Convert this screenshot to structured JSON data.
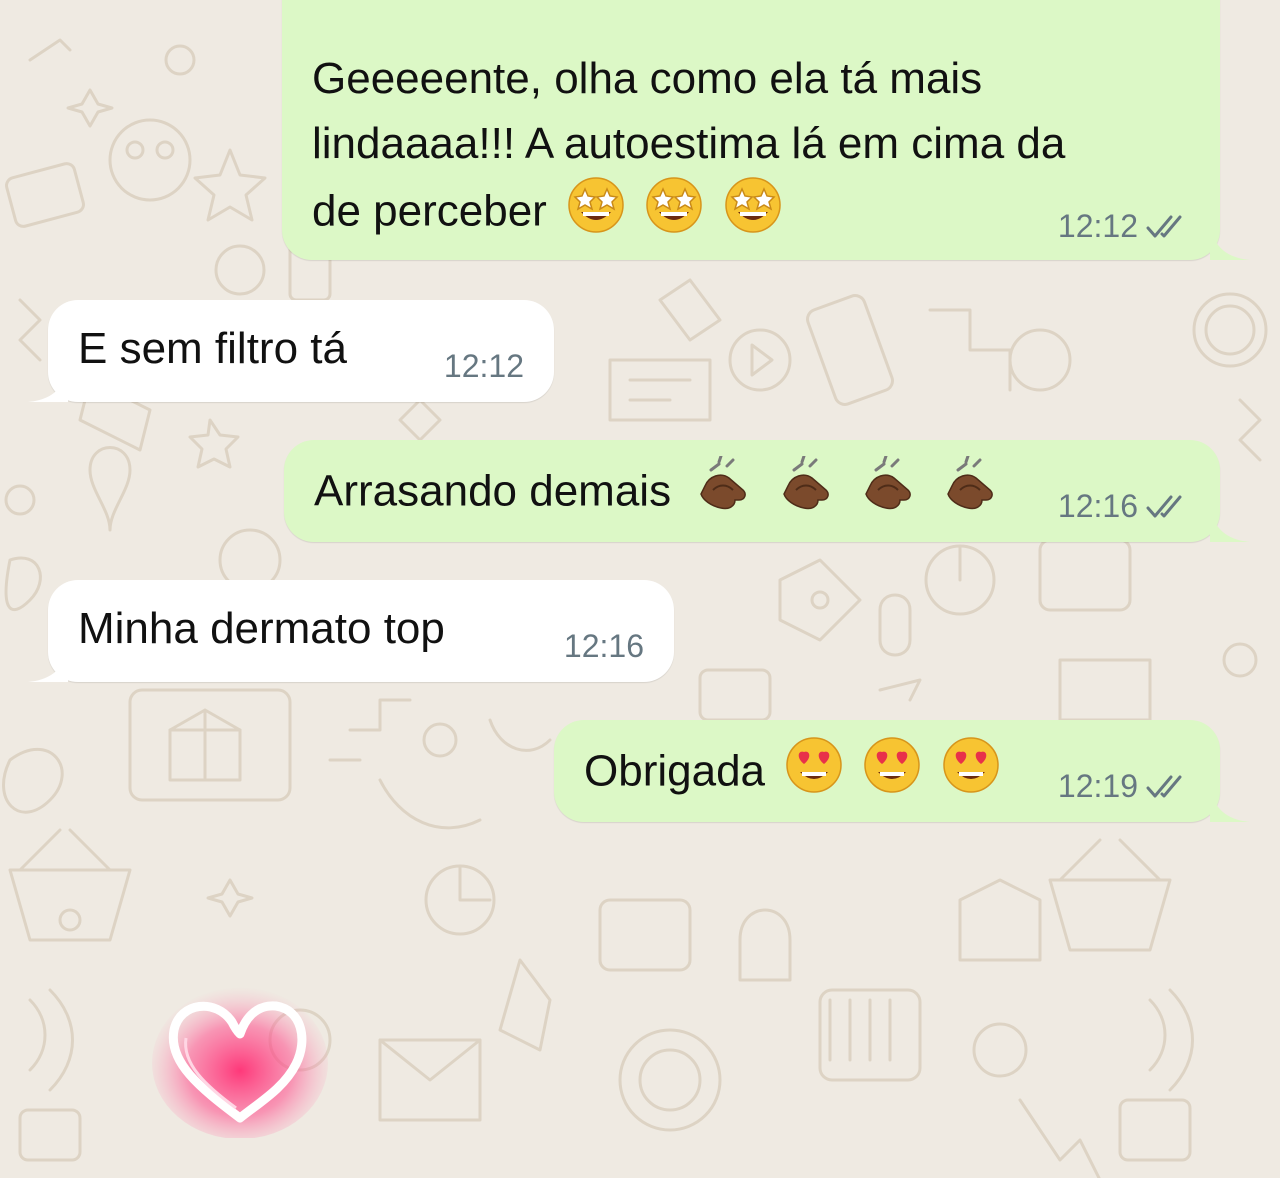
{
  "chat": {
    "messages": [
      {
        "direction": "outgoing",
        "lines": [
          "Geeeeente, olha como ela tá mais",
          "lindaaaa!!! A autoestima lá em cima da",
          "de perceber"
        ],
        "emoji": [
          "star-struck",
          "star-struck",
          "star-struck"
        ],
        "time": "12:12",
        "status": "read"
      },
      {
        "direction": "incoming",
        "text": "E sem filtro tá",
        "time": "12:12"
      },
      {
        "direction": "outgoing",
        "text": "Arrasando demais",
        "emoji": [
          "clapping-hands",
          "clapping-hands",
          "clapping-hands",
          "clapping-hands"
        ],
        "time": "12:16",
        "status": "read"
      },
      {
        "direction": "incoming",
        "text": "Minha dermato top",
        "time": "12:16"
      },
      {
        "direction": "outgoing",
        "text": "Obrigada",
        "emoji": [
          "heart-eyes",
          "heart-eyes",
          "heart-eyes"
        ],
        "time": "12:19",
        "status": "read"
      }
    ]
  },
  "colors": {
    "background": "#efeae2",
    "outgoing_bubble": "#dcf8c6",
    "incoming_bubble": "#ffffff",
    "timestamp": "#667781",
    "quote_accent": "#e2386f"
  },
  "icons": {
    "read_receipt": "double-check-icon",
    "sticker": "heart-sticker"
  }
}
